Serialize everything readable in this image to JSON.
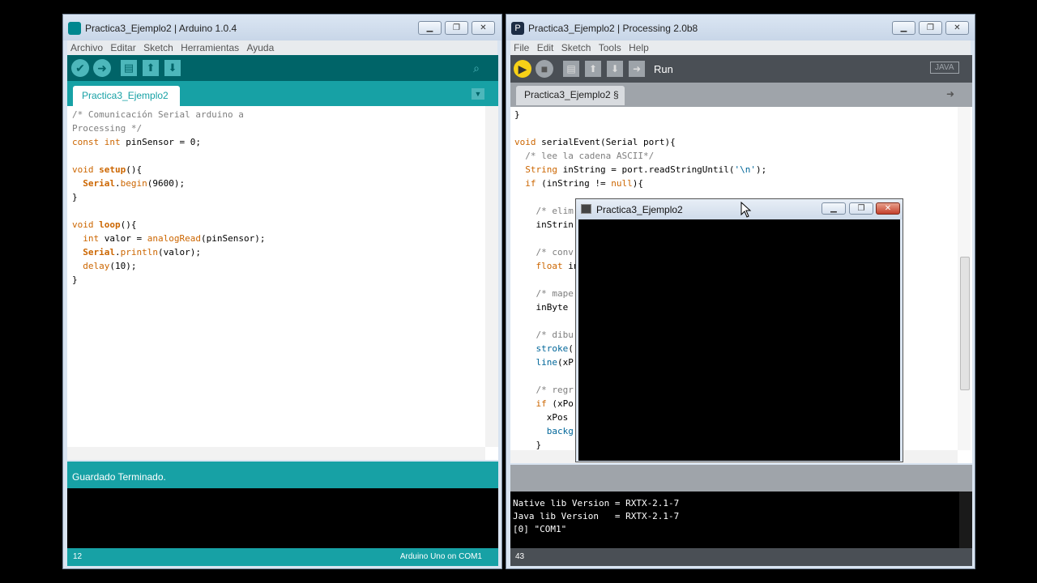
{
  "arduino": {
    "title": "Practica3_Ejemplo2 | Arduino 1.0.4",
    "menu": [
      "Archivo",
      "Editar",
      "Sketch",
      "Herramientas",
      "Ayuda"
    ],
    "tab": "Practica3_Ejemplo2",
    "status": "Guardado Terminado.",
    "line_number": "12",
    "board": "Arduino Uno on COM1",
    "colors": {
      "toolbar": "#006468",
      "tab_bar": "#17a1a5",
      "status": "#17a1a5"
    }
  },
  "processing": {
    "title": "Practica3_Ejemplo2 | Processing 2.0b8",
    "menu": [
      "File",
      "Edit",
      "Sketch",
      "Tools",
      "Help"
    ],
    "run_label": "Run",
    "mode": "JAVA",
    "tab": "Practica3_Ejemplo2 §",
    "console": [
      "Native lib Version = RXTX-2.1-7",
      "Java lib Version   = RXTX-2.1-7",
      "[0] \"COM1\""
    ],
    "line_number": "43",
    "colors": {
      "toolbar": "#4a4f55",
      "tab_bar": "#9fa4aa"
    }
  },
  "sketch_window": {
    "title": "Practica3_Ejemplo2"
  }
}
